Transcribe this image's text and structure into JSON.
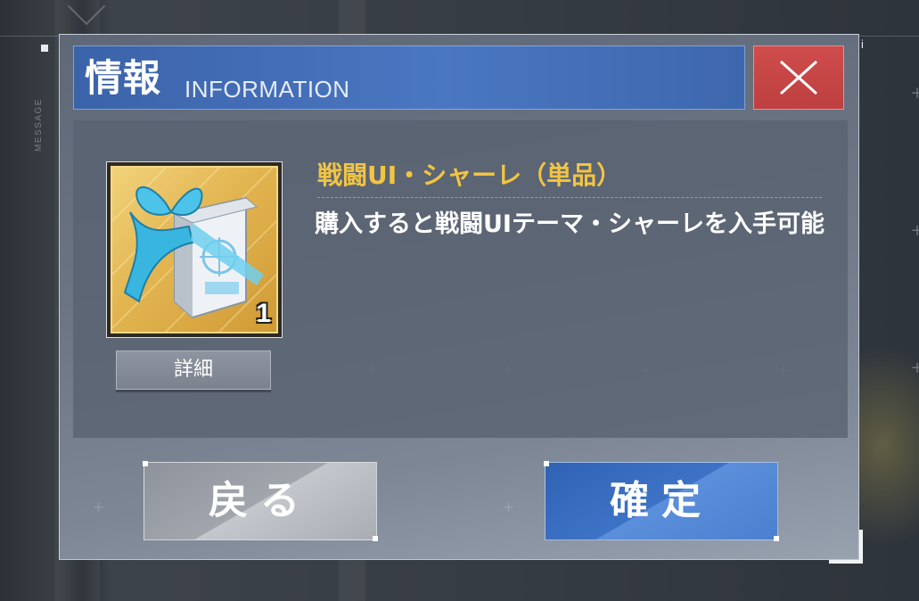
{
  "sidebar": {
    "label": "MESSAGE"
  },
  "dialog": {
    "title_jp": "情報",
    "title_en": "INFORMATION",
    "close_icon": "close-x-icon"
  },
  "item": {
    "icon": "gift-box-icon",
    "count": "1",
    "name": "戦闘UI・シャーレ（単品）",
    "description": "購入すると戦闘UIテーマ・シャーレを入手可能",
    "detail_label": "詳細"
  },
  "buttons": {
    "back_label": "戻る",
    "confirm_label": "確定"
  },
  "colors": {
    "header": "#4a77c2",
    "close": "#cf4d4c",
    "item_name": "#f2c443",
    "confirm": "#3d73c6",
    "back": "#a1a6ad"
  }
}
